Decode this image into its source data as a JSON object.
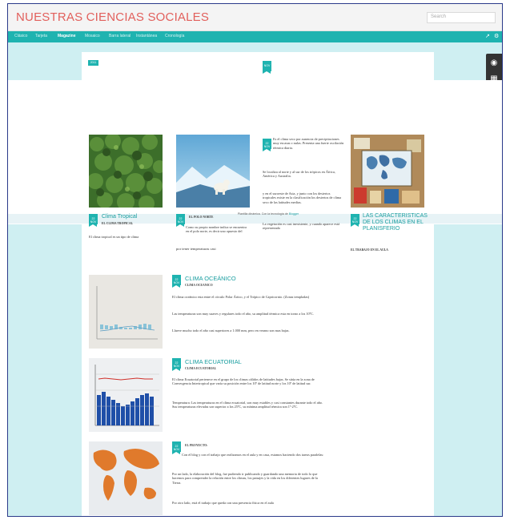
{
  "site": {
    "title": "NUESTRAS CIENCIAS SOCIALES",
    "search_placeholder": "Search",
    "accent": "#1fb3b0",
    "title_color": "#e2605c"
  },
  "nav": {
    "tabs": [
      "Clásico",
      "Tarjeta",
      "Magazine",
      "Mosaico",
      "Barra lateral",
      "Instantánea",
      "Cronología"
    ],
    "active": "Magazine"
  },
  "top_ribbons": [
    {
      "label": "2011"
    },
    {
      "label": "NOV"
    }
  ],
  "cards": [
    {
      "date": "22 NOV",
      "title": "Clima Tropical",
      "subtitle": "EL CLIMA TROPICAL",
      "text": "El clima tropical es un tipo de clima"
    },
    {
      "date": "22 NOV",
      "title": "",
      "subtitle": "EL POLO NORTE",
      "text": "Como su propio nombre indica se encuentra en el polo norte, es decir uno opuesto del"
    },
    {
      "date": "22 NOV",
      "title": "",
      "subtitle": "",
      "paragraphs": [
        "Es el clima seco por ausencia de precipitaciones muy escasas o nulas. Presenta una fuerte oscilación térmica diaria.",
        "Se localiza al norte y al sur de los trópicos en África, América y Australia.",
        "y en el suroeste de Asia, y junto con los desiertos tropicales existe en la clasificación los desiertos de clima seco de las latitudes medias.",
        "La vegetación es casi inexistente, y cuando aparece está representada"
      ]
    },
    {
      "date": "22 NOV",
      "title": "LAS CARACTERISTICAS DE LOS CLIMAS EN EL PLANISFERIO",
      "subtitle": "EL TRABAJO EN EL AULA",
      "text": ""
    }
  ],
  "notice": {
    "prefix": "Plantilla dinámica. Con la tecnología de",
    "link": "Blogger"
  },
  "polo_extra_text": "por tener temperaturas casi",
  "posts": [
    {
      "date": "22 NOV",
      "title": "CLIMA OCEÁNICO",
      "subtitle": "CLIMA OCEANICO",
      "paragraphs": [
        "El clima oceánico esta entre el círculo Polar Ártico, y el Trópico de Capricornio. (Zonas templadas)",
        "Las temperaturas son muy suaves y regulares todo el año, su amplitud térmica esta en torno a los 10ºC.",
        "Llueve mucho todo el año casi superiores a 1.000 mm, pero en verano son mas bajas."
      ]
    },
    {
      "date": "22 NOV",
      "title": "CLIMA ECUATORIAL",
      "subtitle": "CLIMA ECUATORIAL",
      "paragraphs": [
        "El clima Ecuatorial pertenece en el grupo de los climas cálidos de latitudes bajas. Se sitúa en la zona de Convergencia Intertropical que varía su posición entre los 10º de latitud norte y los 10º de latitud sur.",
        "Temperatura: Las temperaturas en el clima ecuatorial, son muy estables y casi constantes durante todo el año. Sus temperaturas elevadas son superior a los 25ºC, su mínima amplitud térmica son 1º-2ºC."
      ]
    },
    {
      "date": "22 NOV",
      "title": "",
      "subtitle": "EL PROYECTO:",
      "paragraphs": [
        "Con el blog y con el trabajo que realizamos en el aula y en casa, estamos haciendo dos tareas paralelas:",
        "Por un lado, la elaboración del blog, fue pudiendo ir publicando y guardando una memoria de todo lo que hacemos para comprender la relación entre los climas, los paisajes y la vida en los diferentes lugares de la Tierra.",
        "Por otro lado, está el trabajo que queda con una presencia física en el aula"
      ]
    }
  ]
}
